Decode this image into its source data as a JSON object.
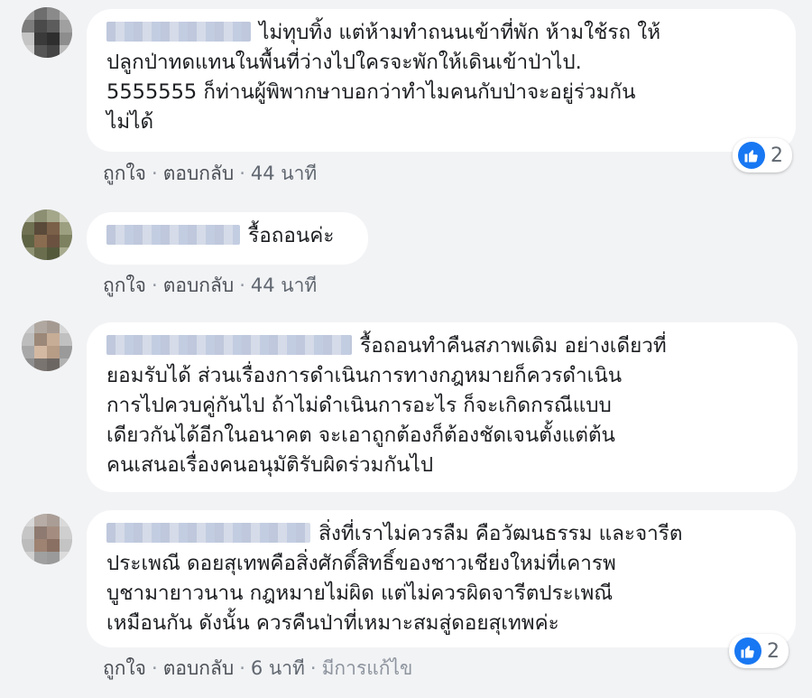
{
  "comments": [
    {
      "text_line1": "ไม่ทุบทิ้ง แต่ห้ามทำถนนเข้าที่พัก ห้ามใช้รถ ให้",
      "text_line2": "ปลูกป่าทดแทนในพื้นที่ว่างไปใครจะพักให้เดินเข้าป่าไป.",
      "text_line3": "5555555 ก็ท่านผู้พิพากษาบอกว่าทำไมคนกับป่าจะอยู่ร่วมกัน",
      "text_line4": "ไม่ได้",
      "like": "ถูกใจ",
      "reply": "ตอบกลับ",
      "time": "44 นาที",
      "reaction_count": "2"
    },
    {
      "text_line1": "รื้อถอนค่ะ",
      "like": "ถูกใจ",
      "reply": "ตอบกลับ",
      "time": "44 นาที"
    },
    {
      "text_line1": "รื้อถอนทำคืนสภาพเดิม อย่างเดียวที่",
      "text_line2": "ยอมรับได้ ส่วนเรื่องการดำเนินการทางกฎหมายก็ควรดำเนิน",
      "text_line3": "การไปควบคู่กันไป ถ้าไม่ดำเนินการอะไร ก็จะเกิดกรณีแบบ",
      "text_line4": "เดียวกันได้อีกในอนาคต จะเอาถูกต้องก็ต้องชัดเจนตั้งแต่ต้น",
      "text_line5": "คนเสนอเรื่องคนอนุมัติรับผิดร่วมกันไป"
    },
    {
      "text_line1": "สิ่งที่เราไม่ควรลืม คือวัฒนธรรม และจารีต",
      "text_line2": "ประเพณี ดอยสุเทพคือสิ่งศักดิ์สิทธิ์ของชาวเชียงใหม่ที่เคารพ",
      "text_line3": "บูชามายาวนาน กฎหมายไม่ผิด แต่ไม่ควรผิดจารีตประเพณี",
      "text_line4": "เหมือนกัน ดังนั้น ควรคืนป่าที่เหมาะสมสู่ดอยสุเทพค่ะ",
      "like": "ถูกใจ",
      "reply": "ตอบกลับ",
      "time": "6 นาที",
      "edited": "มีการแก้ไข",
      "reaction_count": "2"
    }
  ],
  "icons": {
    "reaction": "thumbs-up-icon"
  },
  "colors": {
    "background": "#f2f3f5",
    "bubble": "#ffffff",
    "like_blue": "#1877f2",
    "meta": "#606770"
  }
}
